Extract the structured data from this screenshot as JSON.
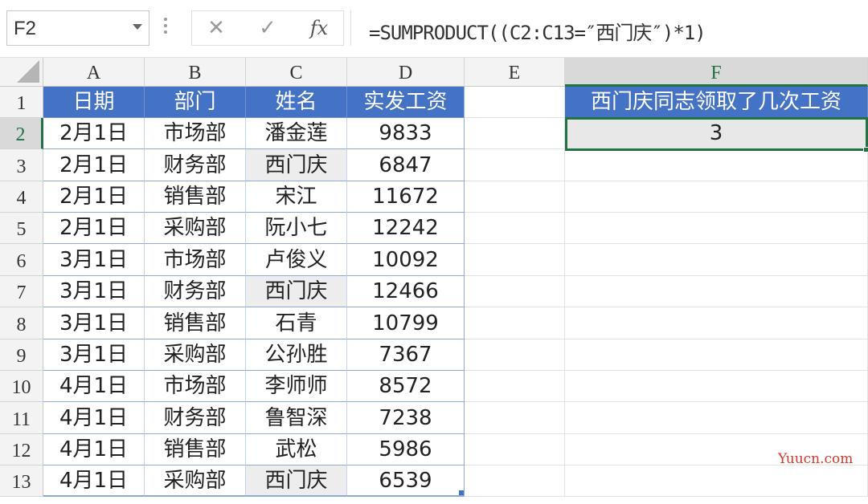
{
  "name_box": {
    "value": "F2"
  },
  "formula_bar": {
    "cancel_glyph": "✕",
    "enter_glyph": "✓",
    "fx_label": "fx",
    "formula": "=SUMPRODUCT((C2:C13=″西门庆″)*1)"
  },
  "columns": [
    "A",
    "B",
    "C",
    "D",
    "E",
    "F"
  ],
  "selected_column": "F",
  "rows": [
    "1",
    "2",
    "3",
    "4",
    "5",
    "6",
    "7",
    "8",
    "9",
    "10",
    "11",
    "12",
    "13"
  ],
  "selected_row": "2",
  "table": {
    "headers": [
      "日期",
      "部门",
      "姓名",
      "实发工资"
    ],
    "records": [
      [
        "2月1日",
        "市场部",
        "潘金莲",
        "9833"
      ],
      [
        "2月1日",
        "财务部",
        "西门庆",
        "6847"
      ],
      [
        "2月1日",
        "销售部",
        "宋江",
        "11672"
      ],
      [
        "2月1日",
        "采购部",
        "阮小七",
        "12242"
      ],
      [
        "3月1日",
        "市场部",
        "卢俊义",
        "10092"
      ],
      [
        "3月1日",
        "财务部",
        "西门庆",
        "12466"
      ],
      [
        "3月1日",
        "销售部",
        "石青",
        "10799"
      ],
      [
        "3月1日",
        "采购部",
        "公孙胜",
        "7367"
      ],
      [
        "4月1日",
        "市场部",
        "李师师",
        "8572"
      ],
      [
        "4月1日",
        "财务部",
        "鲁智深",
        "7238"
      ],
      [
        "4月1日",
        "销售部",
        "武松",
        "5986"
      ],
      [
        "4月1日",
        "采购部",
        "西门庆",
        "6539"
      ]
    ]
  },
  "question": {
    "label": "西门庆同志领取了几次工资",
    "answer": "3"
  },
  "watermark": "Yuucn.com",
  "colors": {
    "table_header_bg": "#4472c4",
    "table_header_text": "#ffffff",
    "highlight_fill": "#ededed",
    "selection_green": "#217346",
    "watermark": "#d23a2a"
  }
}
